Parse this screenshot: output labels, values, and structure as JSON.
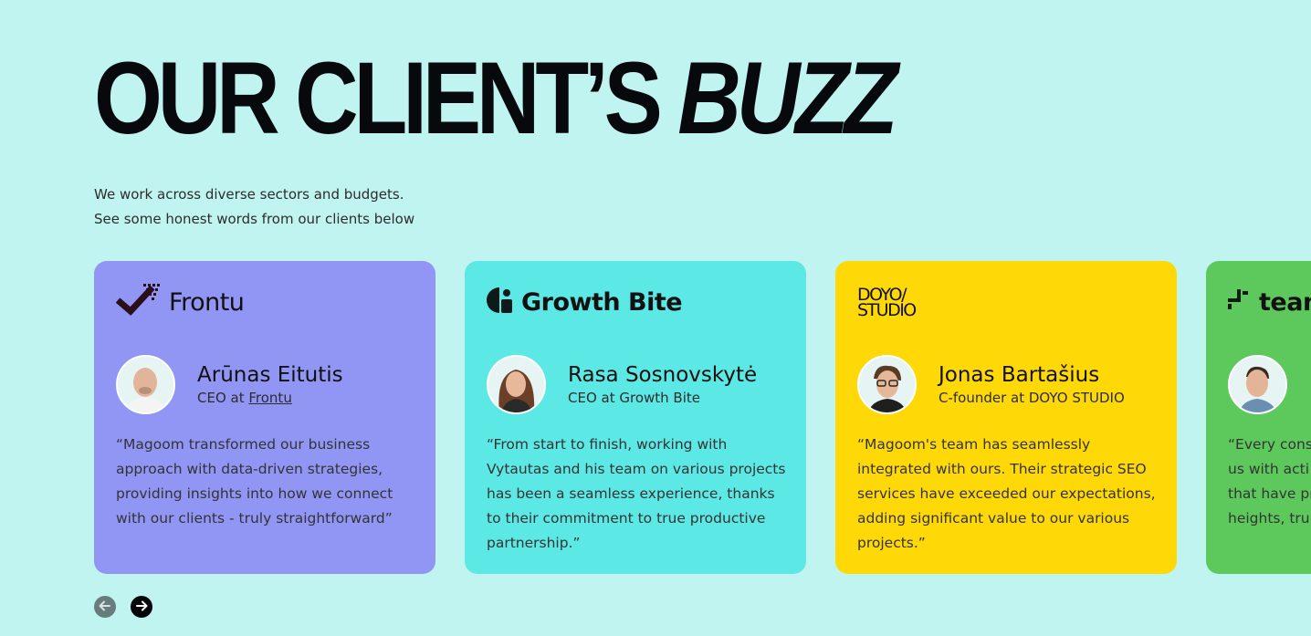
{
  "header": {
    "title_main": "OUR CLIENT’S ",
    "title_accent": "BUZZ",
    "subtitle_line1": "We work across diverse sectors and budgets.",
    "subtitle_line2": "See some honest words from our clients below"
  },
  "testimonials": [
    {
      "color": "#9196f5",
      "logo_icon": "frontu-check-icon",
      "logo_text": "Frontu",
      "name": "Arūnas Eitutis",
      "role_prefix": "CEO at ",
      "role_company": "Frontu",
      "quote": [
        "“Magoom transformed our business",
        "approach with data-driven strategies,",
        "providing insights into how we connect",
        "with our clients - truly straightforward”"
      ]
    },
    {
      "color": "#5ce8e4",
      "logo_icon": "growth-bite-icon",
      "logo_text": "Growth Bite",
      "name": "Rasa Sosnovskytė",
      "role": "CEO at Growth Bite",
      "quote": [
        "“From start to finish, working with",
        "Vytautas and his team on various projects",
        "has been a seamless experience, thanks",
        "to their commitment to true productive",
        "partnership.”"
      ]
    },
    {
      "color": "#ffd907",
      "logo_line1": "DOYO/",
      "logo_line2": "STUDIO",
      "name": "Jonas Bartašius",
      "role": "C-founder at DOYO STUDIO",
      "quote": [
        "“Magoom's team has seamlessly",
        "integrated with ours. Their strategic SEO",
        "services have exceeded our expectations,",
        "adding significant value to our various",
        "projects.”"
      ]
    },
    {
      "color": "#5dc95d",
      "logo_icon": "team-logo-icon",
      "logo_text": "tean",
      "name": "",
      "role": "",
      "quote": [
        "“Every cons",
        "us with acti",
        "that have pr",
        "heights, trul"
      ]
    }
  ],
  "navigation": {
    "prev_icon": "arrow-left-icon",
    "next_icon": "arrow-right-icon"
  }
}
